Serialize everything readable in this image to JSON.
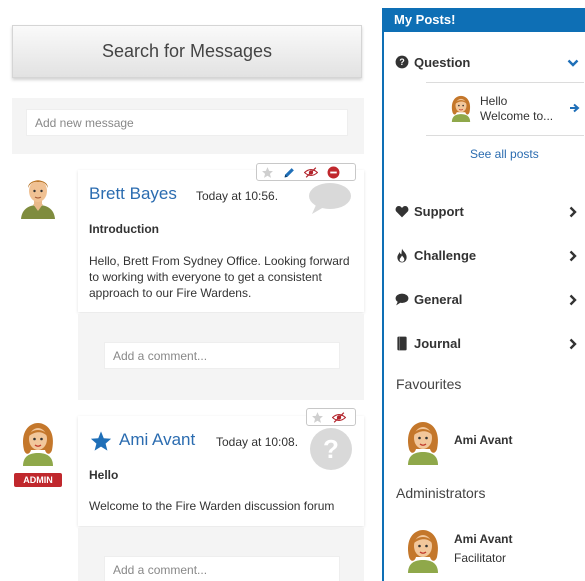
{
  "search": {
    "label": "Search for Messages"
  },
  "new_message": {
    "placeholder": "Add new message"
  },
  "posts": [
    {
      "author": "Brett Bayes",
      "time": "Today at 10:56.",
      "subject": "Introduction",
      "body": "Hello, Brett From Sydney Office. Looking forward to working with everyone to get a consistent approach to our Fire Wardens.",
      "comment_placeholder": "Add a comment...",
      "toolbar": [
        "star-icon",
        "edit-icon",
        "hide-icon",
        "delete-icon"
      ],
      "status_icon": "speech-bubble-icon"
    },
    {
      "author": "Ami Avant",
      "badge": "ADMIN",
      "time": "Today at 10:08.",
      "subject": "Hello",
      "body": "Welcome to the Fire Warden discussion forum",
      "comment_placeholder": "Add a comment...",
      "toolbar": [
        "star-icon",
        "hide-icon"
      ],
      "status_icon": "question-icon",
      "favourited": true
    }
  ],
  "sidebar": {
    "title": "My Posts!",
    "categories": [
      {
        "label": "Question",
        "icon": "question-circle-icon",
        "expanded": true
      },
      {
        "label": "Support",
        "icon": "heart-icon",
        "expanded": false
      },
      {
        "label": "Challenge",
        "icon": "fire-icon",
        "expanded": false
      },
      {
        "label": "General",
        "icon": "comment-icon",
        "expanded": false
      },
      {
        "label": "Journal",
        "icon": "book-icon",
        "expanded": false
      }
    ],
    "question_post": {
      "line1": "Hello",
      "line2": "Welcome to..."
    },
    "see_all": "See all posts",
    "favourites_title": "Favourites",
    "favourites": [
      {
        "name": "Ami Avant"
      }
    ],
    "administrators_title": "Administrators",
    "administrators": [
      {
        "name": "Ami Avant",
        "role": "Facilitator"
      }
    ]
  },
  "colors": {
    "accent": "#0e6fb5",
    "link": "#2b6cb0",
    "admin_badge": "#c0282d",
    "panel_bg": "#f4f4f4"
  }
}
